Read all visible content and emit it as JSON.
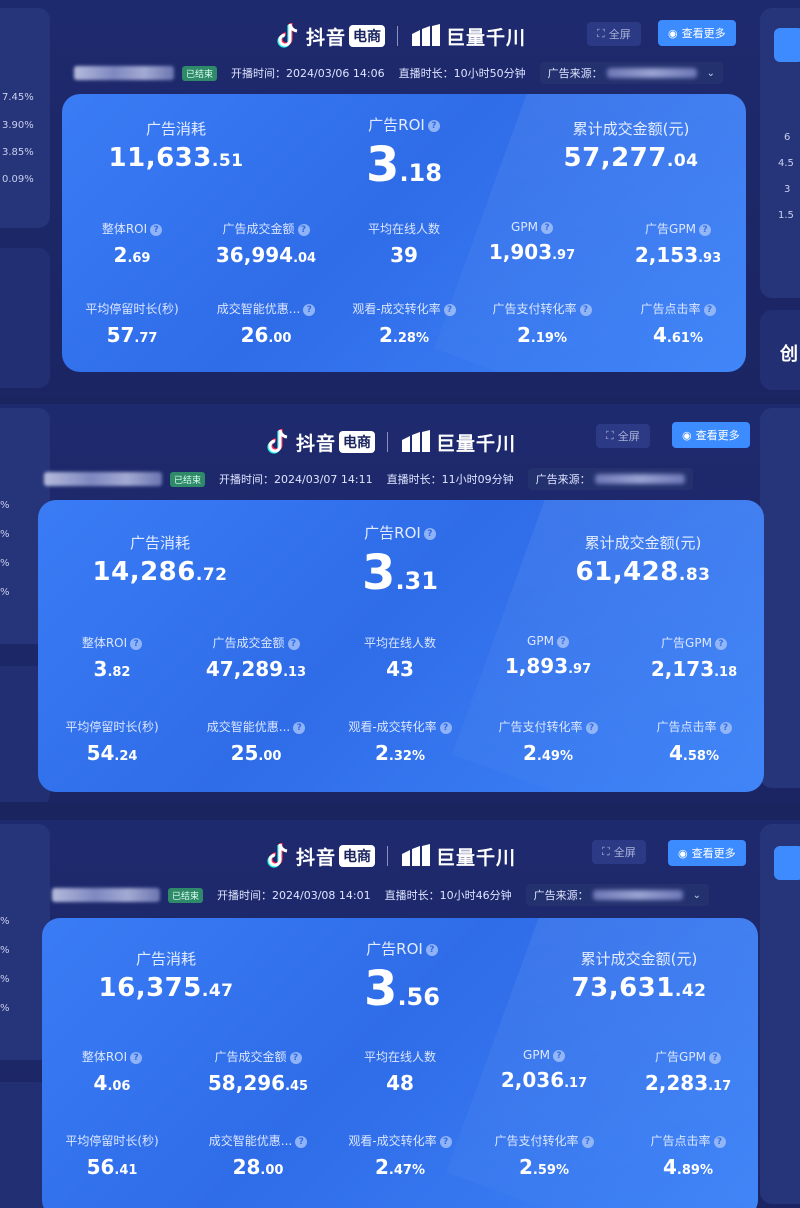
{
  "brand": {
    "douyin": "抖音",
    "douyin_tag": "电商",
    "qianchuan": "巨量千川"
  },
  "buttons": {
    "fullscreen": "全屏",
    "more": "查看更多"
  },
  "labels": {
    "ended": "已结束",
    "start_prefix": "开播时间：",
    "duration_prefix": "直播时长：",
    "source_prefix": "广告来源：",
    "ad_spend": "广告消耗",
    "ad_roi": "广告ROI",
    "total_gmv": "累计成交金额(元)",
    "overall_roi": "整体ROI",
    "ad_gmv": "广告成交金额",
    "avg_online": "平均在线人数",
    "gpm": "GPM",
    "ad_gpm": "广告GPM",
    "avg_stay": "平均停留时长(秒)",
    "deal_discount": "成交智能优惠...",
    "view_conv": "观看-成交转化率",
    "ad_pay_conv": "广告支付转化率",
    "ad_ctr": "广告点击率"
  },
  "side_left_values": {
    "p0": [
      "7.45%",
      "3.90%",
      "3.85%",
      "0.09%"
    ],
    "p1": [
      "%",
      "%",
      "%",
      "%"
    ],
    "p2": [
      "%",
      "%",
      "%",
      "%"
    ]
  },
  "side_right_values": {
    "p0": [
      "6",
      "4.5",
      "3",
      "1.5"
    ],
    "p0_footer": "创"
  },
  "sessions": [
    {
      "start_time": "2024/03/06 14:06",
      "duration": "10小时50分钟",
      "ad_spend": {
        "int": "11,633",
        "dec": ".51"
      },
      "ad_roi": {
        "int": "3",
        "dec": ".18"
      },
      "total_gmv": {
        "int": "57,277",
        "dec": ".04"
      },
      "overall_roi": {
        "int": "2",
        "dec": ".69"
      },
      "ad_gmv": {
        "int": "36,994",
        "dec": ".04"
      },
      "avg_online": {
        "int": "39",
        "dec": ""
      },
      "gpm": {
        "int": "1,903",
        "dec": ".97"
      },
      "ad_gpm": {
        "int": "2,153",
        "dec": ".93"
      },
      "avg_stay": {
        "int": "57",
        "dec": ".77"
      },
      "deal_discount": {
        "int": "26",
        "dec": ".00"
      },
      "view_conv": {
        "int": "2",
        "dec": ".28%"
      },
      "ad_pay_conv": {
        "int": "2",
        "dec": ".19%"
      },
      "ad_ctr": {
        "int": "4",
        "dec": ".61%"
      }
    },
    {
      "start_time": "2024/03/07 14:11",
      "duration": "11小时09分钟",
      "ad_spend": {
        "int": "14,286",
        "dec": ".72"
      },
      "ad_roi": {
        "int": "3",
        "dec": ".31"
      },
      "total_gmv": {
        "int": "61,428",
        "dec": ".83"
      },
      "overall_roi": {
        "int": "3",
        "dec": ".82"
      },
      "ad_gmv": {
        "int": "47,289",
        "dec": ".13"
      },
      "avg_online": {
        "int": "43",
        "dec": ""
      },
      "gpm": {
        "int": "1,893",
        "dec": ".97"
      },
      "ad_gpm": {
        "int": "2,173",
        "dec": ".18"
      },
      "avg_stay": {
        "int": "54",
        "dec": ".24"
      },
      "deal_discount": {
        "int": "25",
        "dec": ".00"
      },
      "view_conv": {
        "int": "2",
        "dec": ".32%"
      },
      "ad_pay_conv": {
        "int": "2",
        "dec": ".49%"
      },
      "ad_ctr": {
        "int": "4",
        "dec": ".58%"
      }
    },
    {
      "start_time": "2024/03/08 14:01",
      "duration": "10小时46分钟",
      "ad_spend": {
        "int": "16,375",
        "dec": ".47"
      },
      "ad_roi": {
        "int": "3",
        "dec": ".56"
      },
      "total_gmv": {
        "int": "73,631",
        "dec": ".42"
      },
      "overall_roi": {
        "int": "4",
        "dec": ".06"
      },
      "ad_gmv": {
        "int": "58,296",
        "dec": ".45"
      },
      "avg_online": {
        "int": "48",
        "dec": ""
      },
      "gpm": {
        "int": "2,036",
        "dec": ".17"
      },
      "ad_gpm": {
        "int": "2,283",
        "dec": ".17"
      },
      "avg_stay": {
        "int": "56",
        "dec": ".41"
      },
      "deal_discount": {
        "int": "28",
        "dec": ".00"
      },
      "view_conv": {
        "int": "2",
        "dec": ".47%"
      },
      "ad_pay_conv": {
        "int": "2",
        "dec": ".59%"
      },
      "ad_ctr": {
        "int": "4",
        "dec": ".89%"
      }
    }
  ],
  "colors": {
    "background": "#1a2560",
    "card": "#3a7cf5",
    "accent_button": "#3c8cff",
    "ended_badge": "#2f8a6a"
  }
}
